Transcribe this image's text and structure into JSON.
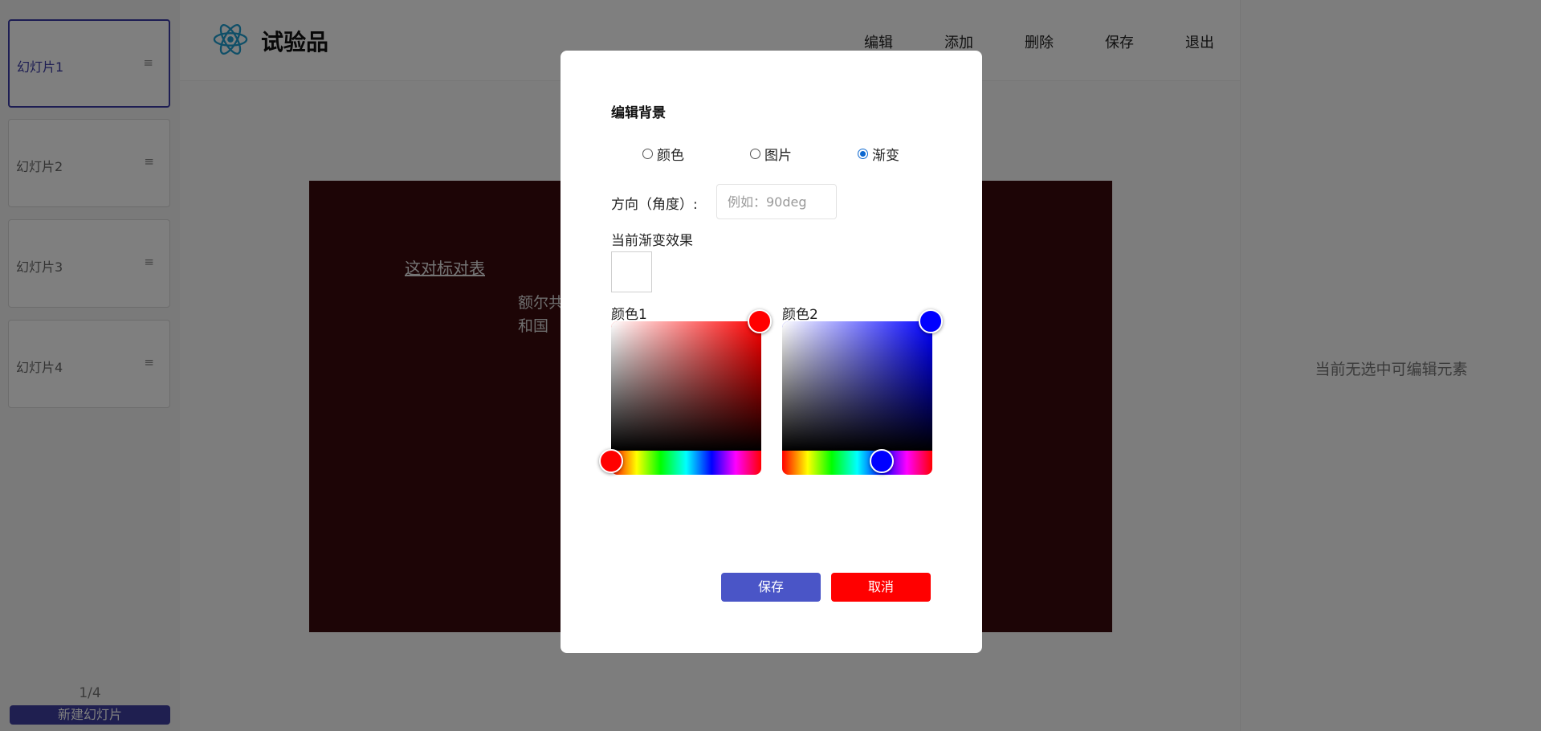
{
  "sidebar": {
    "slides": [
      {
        "label": "幻灯片1",
        "active": true
      },
      {
        "label": "幻灯片2",
        "active": false
      },
      {
        "label": "幻灯片3",
        "active": false
      },
      {
        "label": "幻灯片4",
        "active": false
      }
    ],
    "menu_glyph": "≡",
    "page_count": "1/4",
    "new_slide_label": "新建幻灯片"
  },
  "header": {
    "title": "试验品",
    "nav": [
      "编辑",
      "添加",
      "删除",
      "保存",
      "退出"
    ]
  },
  "slide": {
    "title": "这对标对表",
    "text": "额尔共和国",
    "background": "#3a0b0d"
  },
  "right_panel": {
    "empty_text": "当前无选中可编辑元素"
  },
  "modal": {
    "title": "编辑背景",
    "options": [
      {
        "label": "颜色",
        "checked": false
      },
      {
        "label": "图片",
        "checked": false
      },
      {
        "label": "渐变",
        "checked": true
      }
    ],
    "direction_label": "方向（角度）:",
    "direction_value": "",
    "direction_placeholder": "例如：90deg",
    "current_effect_label": "当前渐变效果",
    "color1_label": "颜色1",
    "color2_label": "颜色2",
    "color1": "#ff0000",
    "color2": "#0000ff",
    "save_label": "保存",
    "cancel_label": "取消"
  },
  "colors": {
    "accent": "#3f3fa0",
    "save_button": "#4a55c7",
    "cancel_button": "#ff0000",
    "radio_checked": "#0b67d0",
    "logo": "#1e9fd0"
  }
}
